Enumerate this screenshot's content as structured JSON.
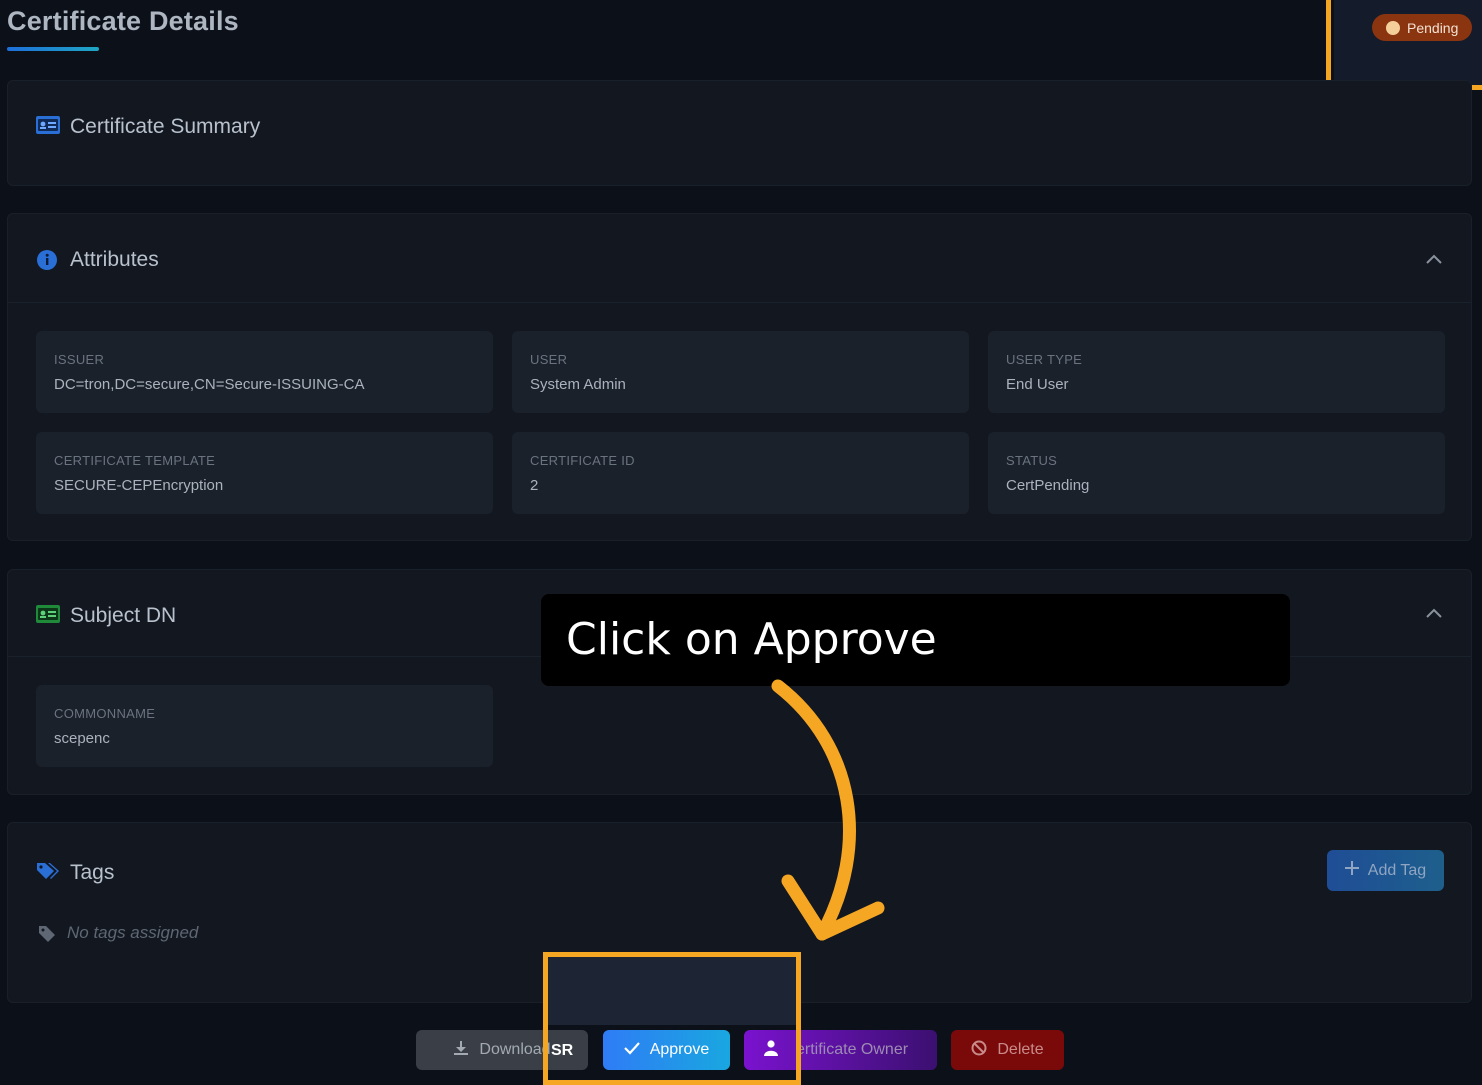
{
  "page": {
    "title": "Certificate Details"
  },
  "status_badge": {
    "label": "Pending"
  },
  "summary": {
    "title": "Certificate Summary"
  },
  "attributes": {
    "title": "Attributes",
    "fields": [
      {
        "label": "ISSUER",
        "value": "DC=tron,DC=secure,CN=Secure-ISSUING-CA"
      },
      {
        "label": "USER",
        "value": "System Admin"
      },
      {
        "label": "USER TYPE",
        "value": "End User"
      },
      {
        "label": "CERTIFICATE TEMPLATE",
        "value": "SECURE-CEPEncryption"
      },
      {
        "label": "CERTIFICATE ID",
        "value": "2"
      },
      {
        "label": "STATUS",
        "value": "CertPending"
      }
    ]
  },
  "subject_dn": {
    "title": "Subject DN",
    "fields": [
      {
        "label": "COMMONNAME",
        "value": "scepenc"
      }
    ]
  },
  "tags": {
    "title": "Tags",
    "add_label": "Add Tag",
    "empty_text": "No tags assigned"
  },
  "actions": {
    "download_label": "Download",
    "download_suffix": "SR",
    "approve_label": "Approve",
    "owner_label": "ertificate Owner",
    "delete_label": "Delete"
  },
  "tooltip": {
    "text": "Click on Approve"
  },
  "colors": {
    "background": "#0c1018",
    "card": "#121720",
    "field": "#1b212b",
    "accent_blue": "#2f7cf6",
    "highlight": "#f5a623",
    "pending": "#8a3510",
    "delete": "#7a0a0a",
    "owner": "#7a12cf"
  },
  "icons": {
    "summary": "id-card-icon",
    "attributes": "info-circle-icon",
    "subject": "id-card-icon",
    "tags": "tags-icon",
    "tag": "tag-icon",
    "download": "download-icon",
    "approve": "check-icon",
    "owner": "user-icon",
    "delete": "ban-icon",
    "collapse": "chevron-up-icon",
    "add": "plus-icon"
  }
}
